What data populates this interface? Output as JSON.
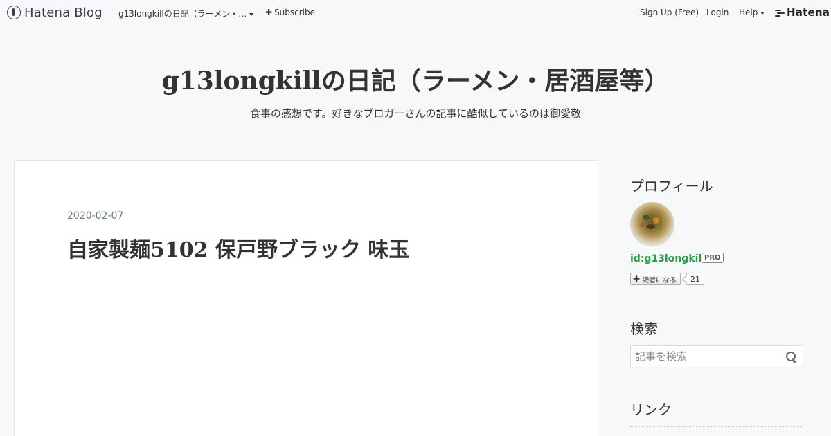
{
  "global_header": {
    "logo_text": "Hatena Blog",
    "blog_name": "g13longkillの日記（ラーメン・…",
    "subscribe_label": "Subscribe",
    "signup_label": "Sign Up (Free)",
    "login_label": "Login",
    "help_label": "Help",
    "hatena_label": "Hatena"
  },
  "blog": {
    "title": "g13longkillの日記（ラーメン・居酒屋等）",
    "description": "食事の感想です。好きなブロガーさんの記事に酷似しているのは御愛敬"
  },
  "article": {
    "date": "2020-02-07",
    "title": "自家製麺5102 保戸野ブラック 味玉"
  },
  "sidebar": {
    "profile": {
      "heading": "プロフィール",
      "user_id": "id:g13longkill",
      "badge": "PRO",
      "reader_button_label": "読者になる",
      "reader_count": "21"
    },
    "search": {
      "heading": "検索",
      "placeholder": "記事を検索"
    },
    "links": {
      "heading": "リンク"
    }
  }
}
